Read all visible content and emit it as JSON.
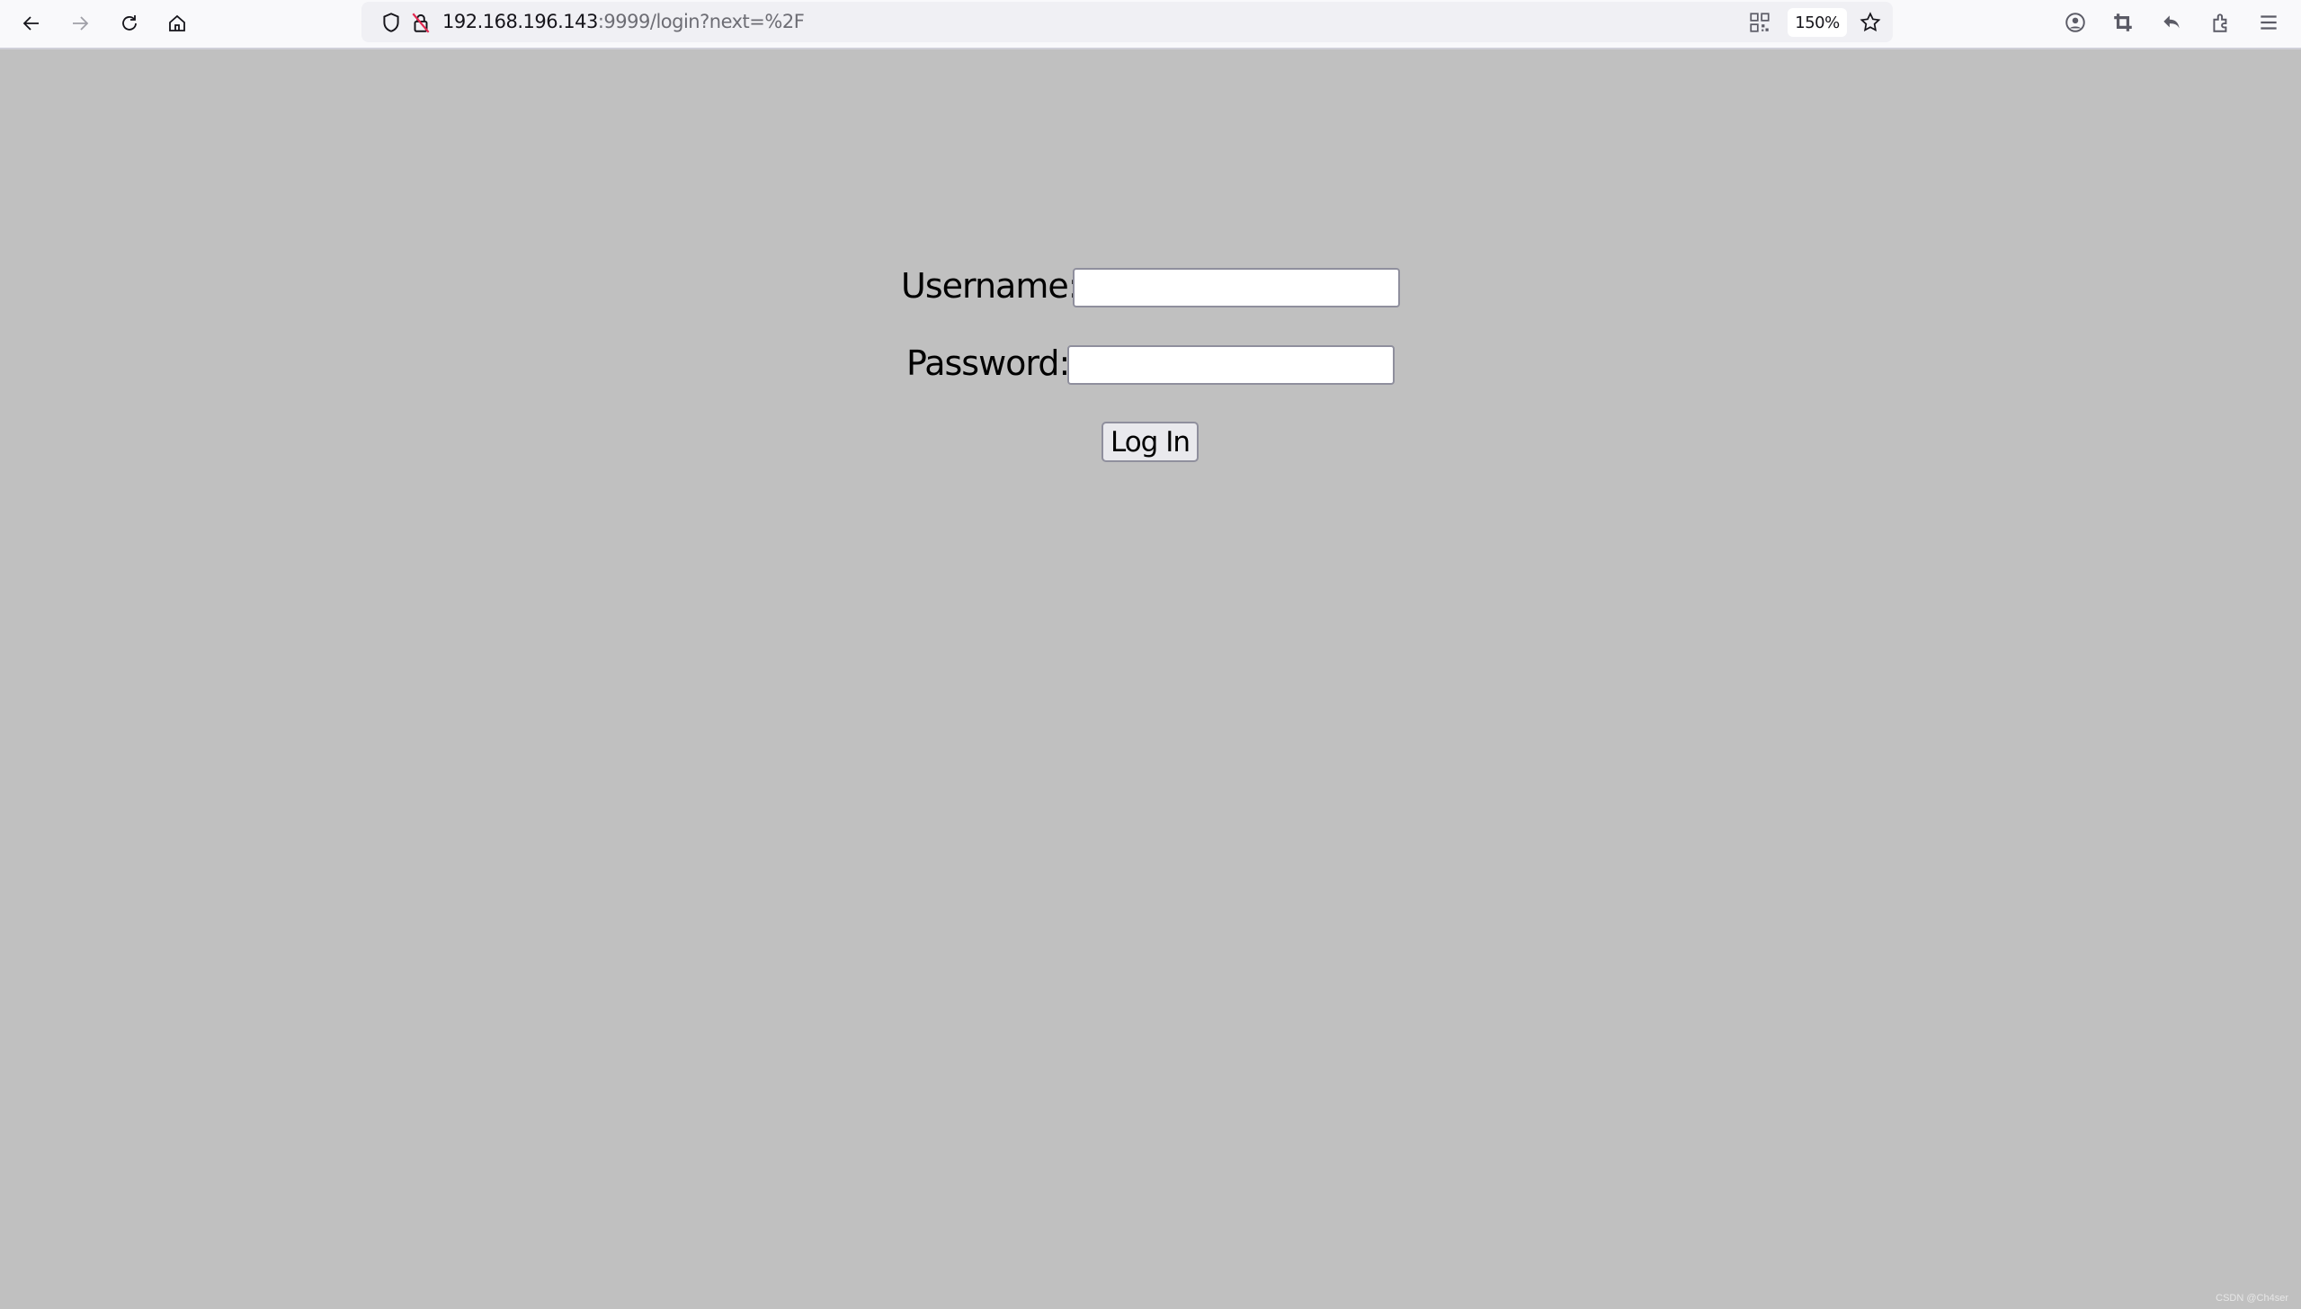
{
  "browser": {
    "url_host": "192.168.196.143",
    "url_rest": ":9999/login?next=%2F",
    "zoom_level": "150%",
    "icons": [
      "back-icon",
      "forward-icon",
      "reload-icon",
      "home-icon",
      "shield-icon",
      "insecure-lock-icon",
      "qr-code-icon",
      "bookmark-star-icon",
      "account-icon",
      "screenshot-crop-icon",
      "undo-icon",
      "extensions-icon",
      "menu-icon"
    ]
  },
  "login_form": {
    "username_label": "Username:",
    "username_value": "",
    "password_label": "Password:",
    "password_value": "",
    "submit_label": "Log In"
  },
  "watermark": "CSDN @Ch4ser"
}
